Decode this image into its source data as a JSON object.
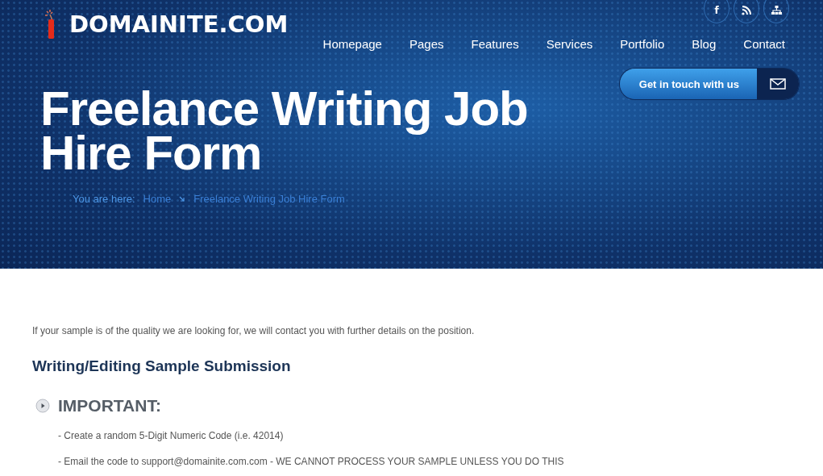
{
  "header": {
    "logo": "DOMAINITE.COM",
    "social": [
      {
        "kind": "facebook",
        "label": "f"
      },
      {
        "kind": "rss"
      },
      {
        "kind": "sitemap"
      }
    ],
    "nav": [
      "Homepage",
      "Pages",
      "Features",
      "Services",
      "Portfolio",
      "Blog",
      "Contact"
    ],
    "cta": "Get in touch with us",
    "title": "Freelance Writing Job Hire Form",
    "breadcrumb": {
      "label": "You are here:",
      "items": [
        "Home",
        "Freelance Writing Job Hire Form"
      ]
    }
  },
  "content": {
    "intro": "If your sample is of the quality we are looking for, we will contact you with further details on the position.",
    "heading": "Writing/Editing Sample Submission",
    "important": "IMPORTANT:",
    "items": [
      "- Create a random 5-Digit Numeric Code (i.e. 42014)",
      "- Email the code to support@domainite.com.com - WE CANNOT PROCESS YOUR SAMPLE UNLESS YOU DO THIS"
    ]
  }
}
